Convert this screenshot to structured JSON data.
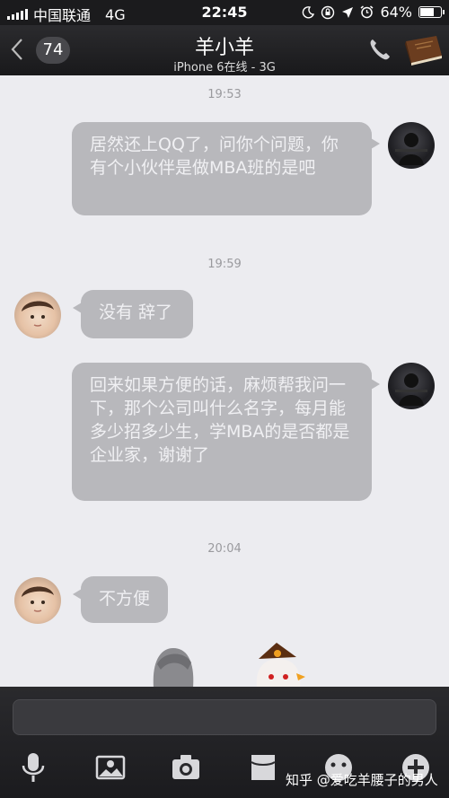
{
  "status_bar": {
    "carrier": "中国联通",
    "network": "4G",
    "time": "22:45",
    "battery": "64%",
    "battery_level": 0.64,
    "icons": [
      "moon-icon",
      "lock-rotation-icon",
      "location-icon",
      "alarm-icon"
    ]
  },
  "nav": {
    "unread_count": "74",
    "title": "羊小羊",
    "subtitle": "iPhone 6在线 - 3G"
  },
  "messages": [
    {
      "type": "timestamp",
      "text": "19:53"
    },
    {
      "type": "message",
      "side": "right",
      "text": "居然还上QQ了，问你个问题，你有个小伙伴是做MBA班的是吧"
    },
    {
      "type": "timestamp",
      "text": "19:59"
    },
    {
      "type": "message",
      "side": "left",
      "text": "没有 辞了"
    },
    {
      "type": "message",
      "side": "right",
      "text": "回来如果方便的话，麻烦帮我问一下，那个公司叫什么名字，每月能多少招多少生，学MBA的是否都是企业家，谢谢了"
    },
    {
      "type": "timestamp",
      "text": "20:04"
    },
    {
      "type": "message",
      "side": "left",
      "text": "不方便"
    }
  ],
  "toolbar": {
    "icons": [
      "microphone-icon",
      "image-icon",
      "camera-icon",
      "folder-icon",
      "emoji-icon",
      "plus-icon"
    ]
  },
  "watermark": "知乎 @爱吃羊腰子的男人",
  "colors": {
    "background": "#ececf0",
    "bubble": "#b8b8bc",
    "bar": "#1b1b1d"
  }
}
